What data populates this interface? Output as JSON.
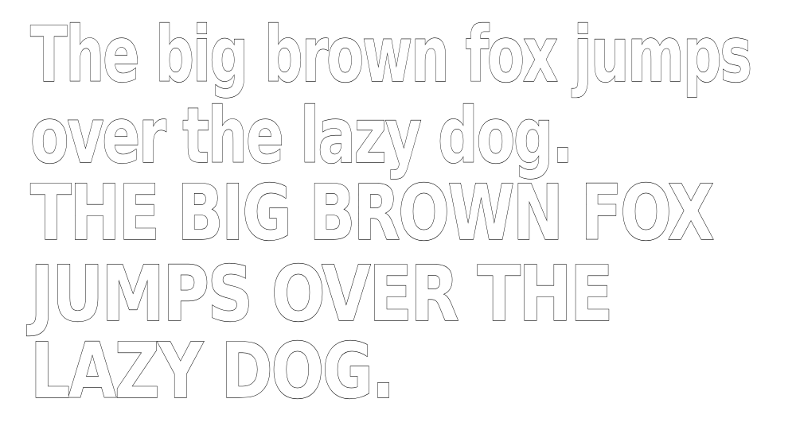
{
  "specimen": {
    "lines": [
      "The big brown fox jumps",
      "over the lazy dog.",
      "THE BIG BROWN FOX",
      "JUMPS OVER THE",
      "LAZY DOG."
    ]
  },
  "colors": {
    "background": "#ffffff",
    "glyph_fill": "#ffffff",
    "glyph_outline": "#000000"
  }
}
